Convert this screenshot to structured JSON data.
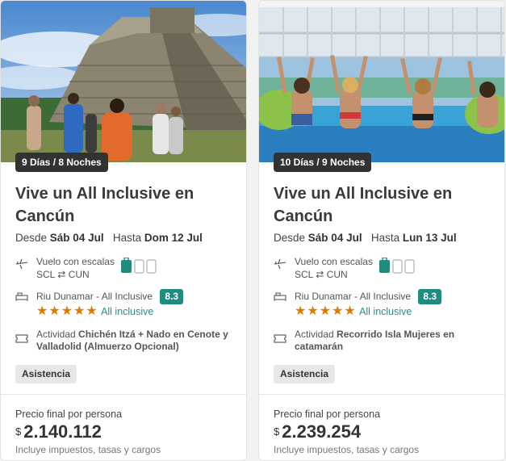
{
  "cards": [
    {
      "duration": "9 Días / 8 Noches",
      "title": "Vive un All Inclusive en Cancún",
      "dates": {
        "from_label": "Desde",
        "from": "Sáb 04 Jul",
        "to_label": "Hasta",
        "to": "Dom 12 Jul"
      },
      "flight": {
        "label": "Vuelo con escalas",
        "origin": "SCL",
        "destination": "CUN",
        "icon": "airplane-icon",
        "arrow_icon": "roundtrip-arrows-icon"
      },
      "hotel": {
        "name": "Riu Dunamar - All Inclusive",
        "score": "8.3",
        "stars": 5,
        "regime": "All inclusive",
        "icon": "bed-icon"
      },
      "activity": {
        "label": "Actividad",
        "name": "Chichén Itzá + Nado en Cenote y Valladolid (Almuerzo Opcional)",
        "icon": "ticket-icon"
      },
      "tag": "Asistencia",
      "price": {
        "label": "Precio final por persona",
        "currency": "$",
        "amount": "2.140.112",
        "note": "Incluye impuestos, tasas y cargos"
      },
      "image": {
        "subject": "Chichén Itzá pyramid with tourists"
      }
    },
    {
      "duration": "10 Días / 9 Noches",
      "title": "Vive un All Inclusive en Cancún",
      "dates": {
        "from_label": "Desde",
        "from": "Sáb 04 Jul",
        "to_label": "Hasta",
        "to": "Lun 13 Jul"
      },
      "flight": {
        "label": "Vuelo con escalas",
        "origin": "SCL",
        "destination": "CUN",
        "icon": "airplane-icon",
        "arrow_icon": "roundtrip-arrows-icon"
      },
      "hotel": {
        "name": "Riu Dunamar - All Inclusive",
        "score": "8.3",
        "stars": 5,
        "regime": "All inclusive",
        "icon": "bed-icon"
      },
      "activity": {
        "label": "Actividad",
        "name": "Recorrido Isla Mujeres en catamarán",
        "icon": "ticket-icon"
      },
      "tag": "Asistencia",
      "price": {
        "label": "Precio final por persona",
        "currency": "$",
        "amount": "2.239.254",
        "note": "Incluye impuestos, tasas y cargos"
      },
      "image": {
        "subject": "People in pool raising arms"
      }
    }
  ],
  "colors": {
    "accent_teal": "#1f8c7e",
    "star_orange": "#e07a00",
    "badge_dark": "#323232"
  }
}
